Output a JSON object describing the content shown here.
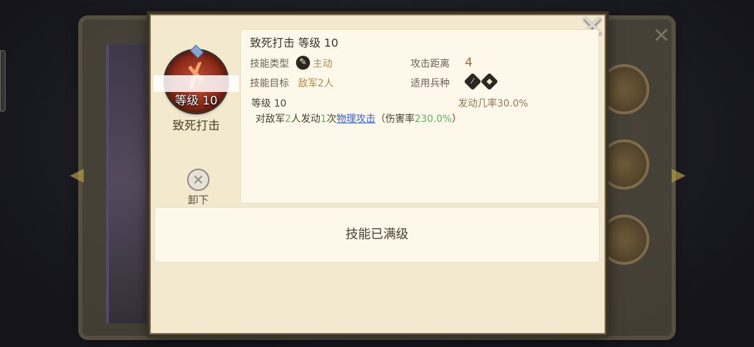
{
  "modal": {
    "close_icon": "close-icon"
  },
  "skill": {
    "badge_level": "等级 10",
    "name": "致死打击",
    "title": "致死打击 等级 10",
    "type_label": "技能类型",
    "type_value": "主动",
    "target_label": "技能目标",
    "target_value": "敌军2人",
    "range_label": "攻击距离",
    "range_value": "4",
    "troop_label": "适用兵种",
    "troop_icons": [
      "lance-icon",
      "shield-icon"
    ],
    "level_text": "等级 10",
    "trigger_label": "发动几率",
    "trigger_value": "30.0%",
    "desc": {
      "part1": "对敌军",
      "targets": "2",
      "part2": "人发动",
      "times": "1",
      "part3": "次",
      "attack_link": "物理攻击",
      "part4": "（伤害率",
      "damage_rate": "230.0%",
      "part5": "）"
    }
  },
  "unequip": {
    "label": "卸下"
  },
  "max_level_text": "技能已满级",
  "colors": {
    "modal_bg": "#f3e9cf",
    "panel_bg": "#fdf8e9",
    "highlight_green": "#5fb35b",
    "link_blue": "#3a5fd0",
    "value_gold": "#b08a4a"
  }
}
